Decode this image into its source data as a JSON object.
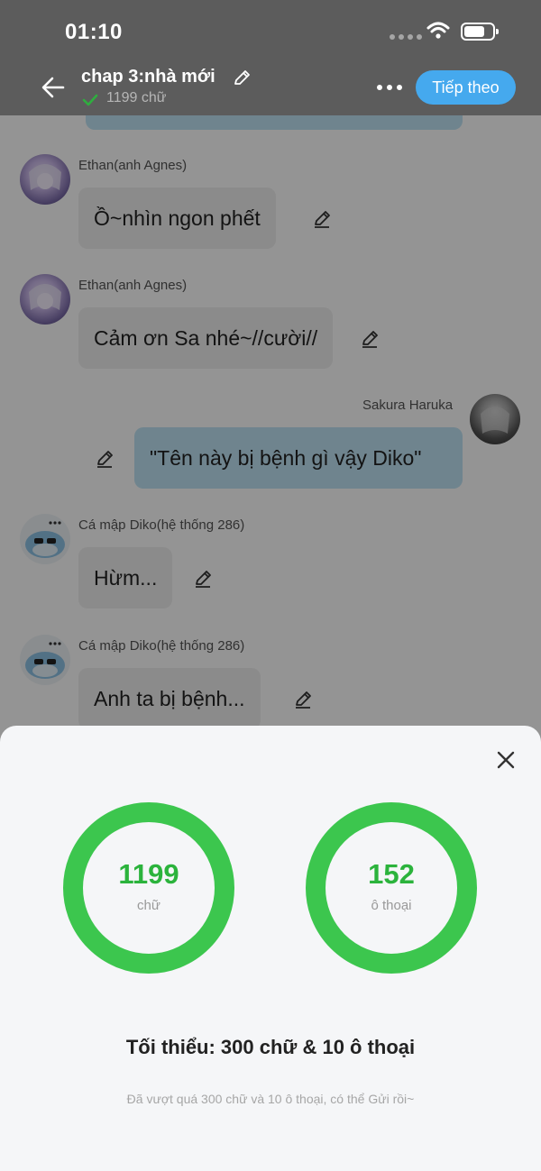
{
  "status_bar": {
    "time": "01:10"
  },
  "header": {
    "title": "chap 3:nhà mới",
    "word_count": "1199 chữ",
    "next_label": "Tiếp theo"
  },
  "messages": [
    {
      "sender": "Ethan(anh Agnes)",
      "text": "Ồ~nhìn ngon phết",
      "side": "left"
    },
    {
      "sender": "Ethan(anh Agnes)",
      "text": "Cảm ơn Sa nhé~//cười//",
      "side": "left"
    },
    {
      "sender": "Sakura Haruka",
      "text": "\"Tên này bị bệnh gì vậy Diko\"",
      "side": "right"
    },
    {
      "sender": "Cá mập Diko(hệ thống 286)",
      "text": "Hừm...",
      "side": "left"
    },
    {
      "sender": "Cá mập Diko(hệ thống 286)",
      "text": "Anh ta bị bệnh...",
      "side": "left"
    }
  ],
  "stats": {
    "words": {
      "value": "1199",
      "unit": "chữ"
    },
    "dialogs": {
      "value": "152",
      "unit": "ô thoại"
    }
  },
  "requirement": {
    "title": "Tối thiểu: 300 chữ & 10 ô thoại",
    "subtitle": "Đã vượt quá 300 chữ và 10 ô thoại, có thể Gửi rồi~"
  },
  "colors": {
    "accent_green": "#3cc64e",
    "button_blue": "#45a9ee",
    "bubble_blue": "#bfe3f5"
  }
}
